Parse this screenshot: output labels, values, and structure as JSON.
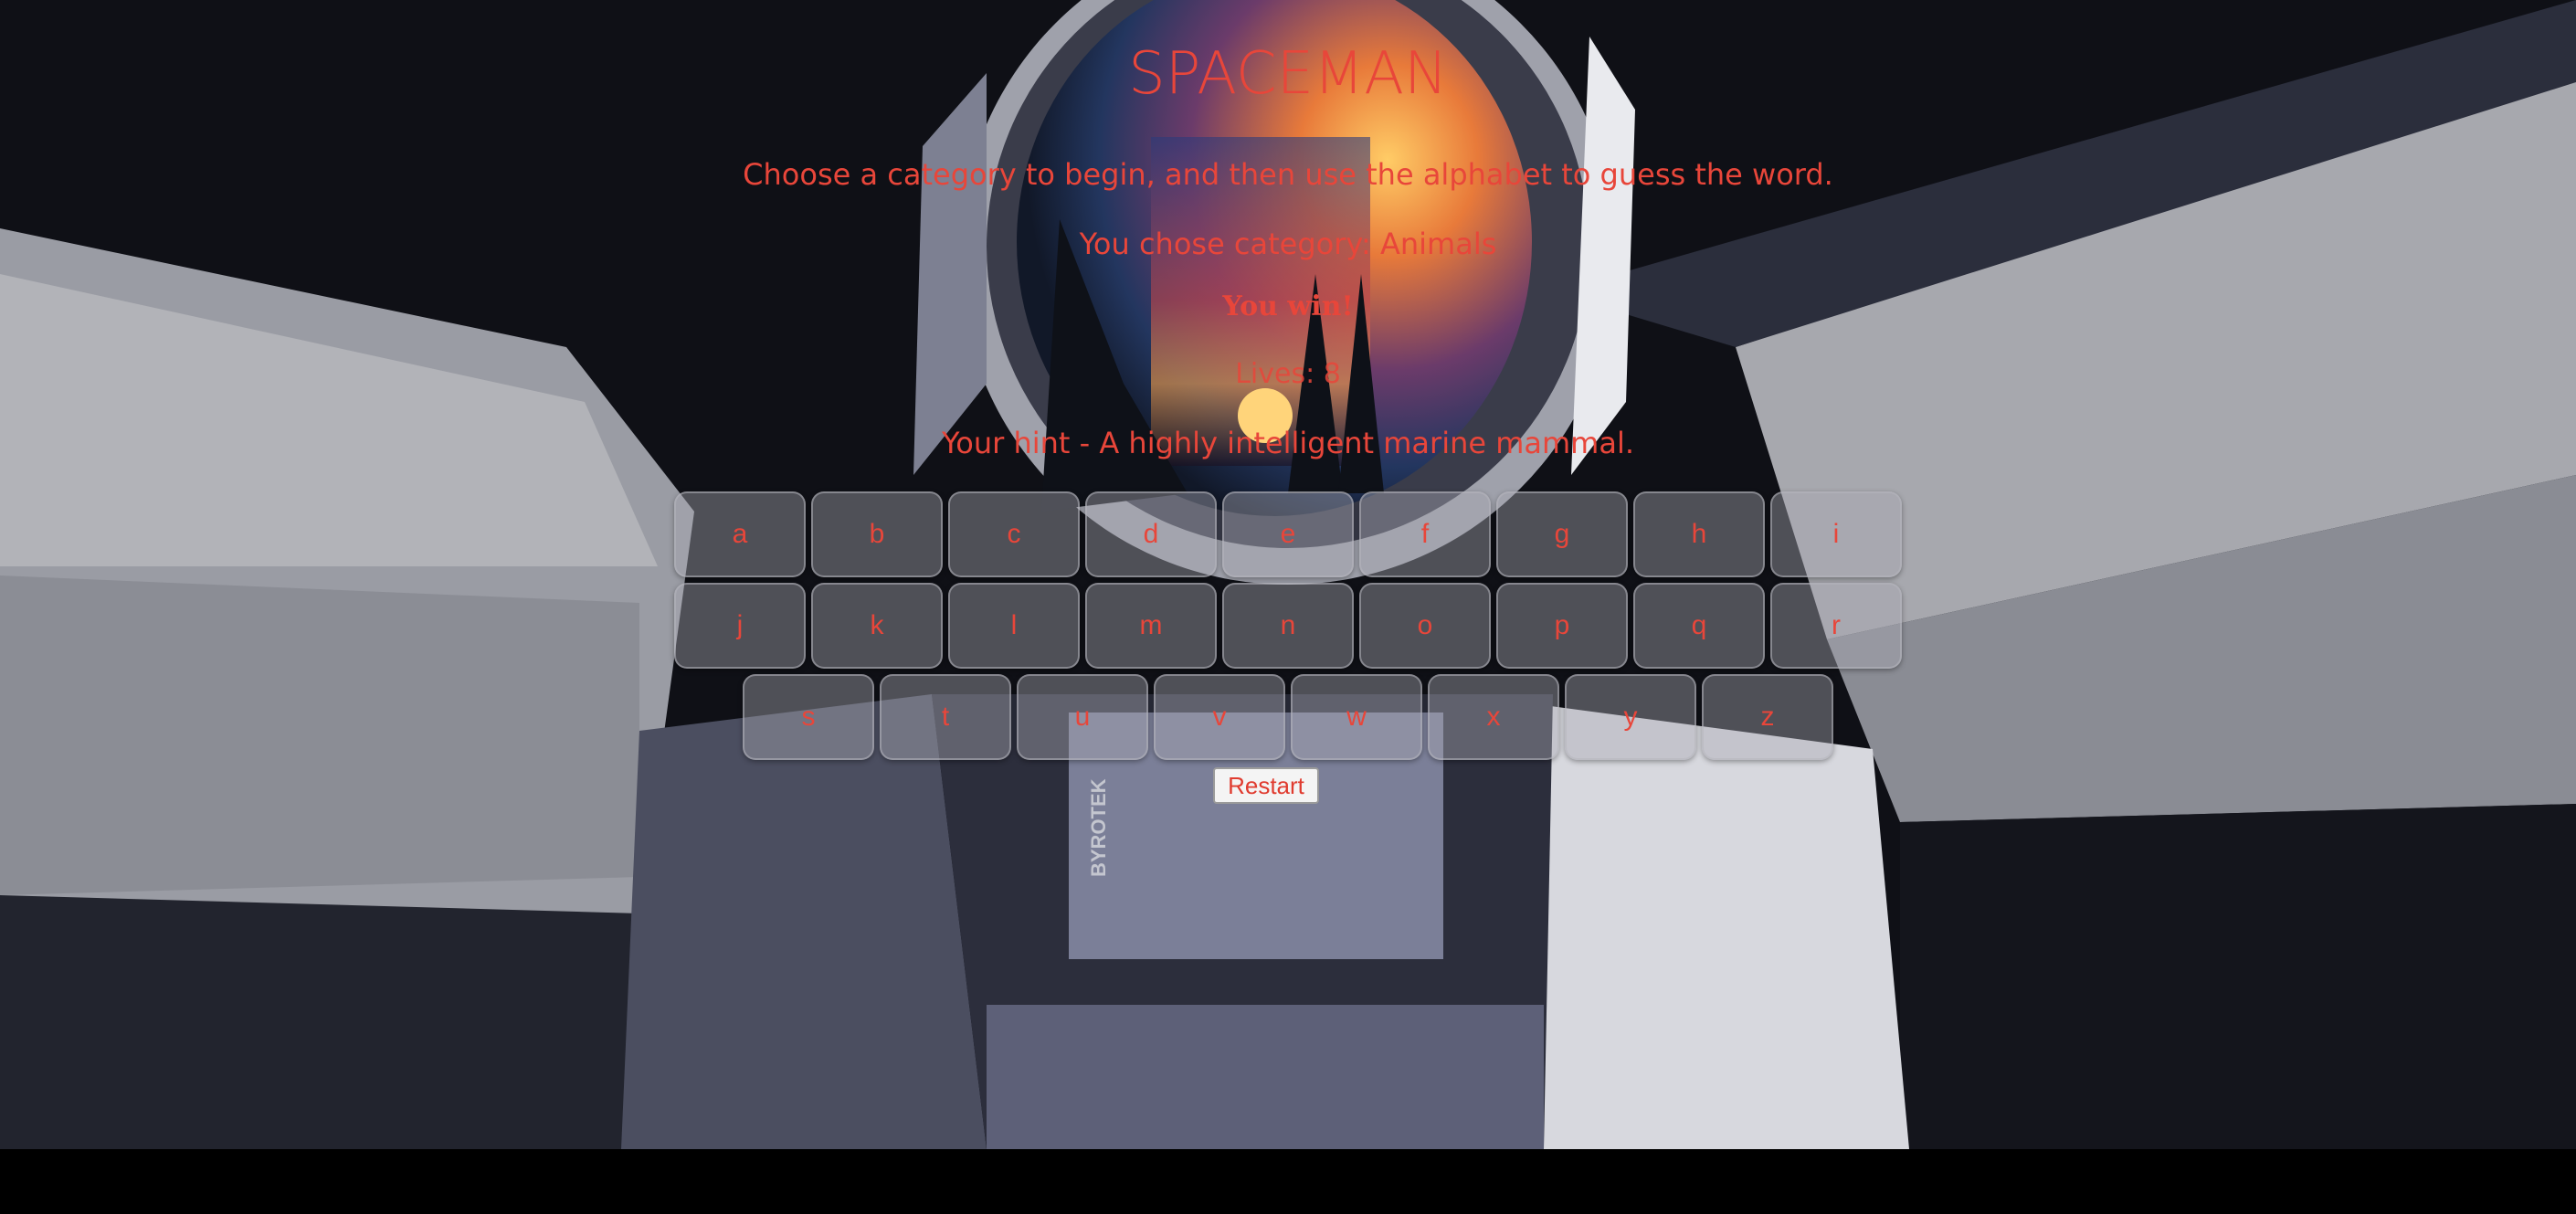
{
  "game": {
    "title": "SPACEMAN",
    "instructions": "Choose a category to begin, and then use the alphabet to guess the word.",
    "category_text": "You chose category: Animals",
    "result_text": "You win!",
    "lives_text": "Lives: 8",
    "hint_text": "Your hint - A highly intelligent marine mammal.",
    "restart_label": "Restart"
  },
  "keyboard": {
    "rows": [
      [
        "a",
        "b",
        "c",
        "d",
        "e",
        "f",
        "g",
        "h",
        "i"
      ],
      [
        "j",
        "k",
        "l",
        "m",
        "n",
        "o",
        "p",
        "q",
        "r"
      ],
      [
        "s",
        "t",
        "u",
        "v",
        "w",
        "x",
        "y",
        "z"
      ]
    ]
  },
  "background": {
    "helmet_badge": "BYROTEK"
  },
  "colors": {
    "accent_text": "#e8463a",
    "page_bg": "#0f1016",
    "key_bg": "rgba(170,170,178,0.42)"
  }
}
